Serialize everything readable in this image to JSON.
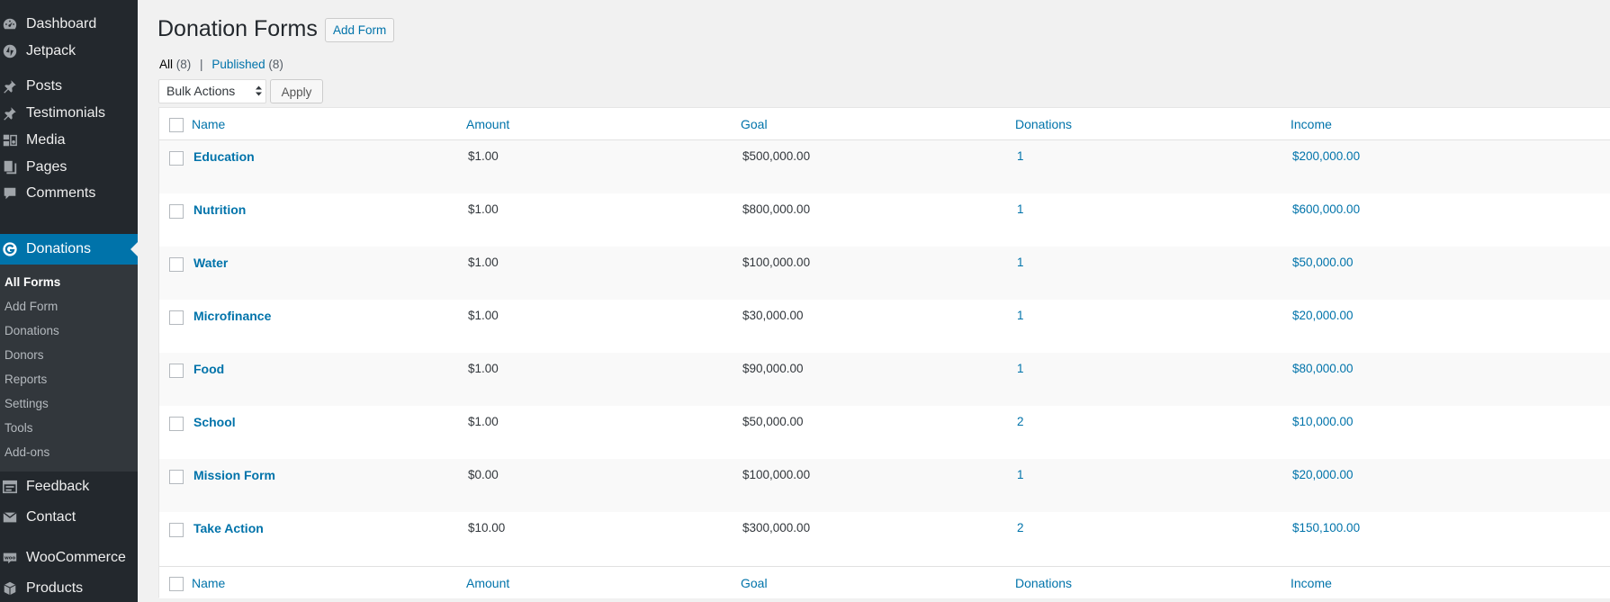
{
  "sidebar": {
    "menu": [
      {
        "label": "Dashboard",
        "icon": "dashboard-icon"
      },
      {
        "label": "Jetpack",
        "icon": "jetpack-icon"
      },
      {
        "label": "Posts",
        "icon": "pin-icon"
      },
      {
        "label": "Testimonials",
        "icon": "pin-icon"
      },
      {
        "label": "Media",
        "icon": "media-icon"
      },
      {
        "label": "Pages",
        "icon": "pages-icon"
      },
      {
        "label": "Comments",
        "icon": "comments-icon"
      },
      {
        "label": "Donations",
        "icon": "donations-icon"
      },
      {
        "label": "Feedback",
        "icon": "feedback-icon"
      },
      {
        "label": "Contact",
        "icon": "mail-icon"
      },
      {
        "label": "WooCommerce",
        "icon": "woocommerce-icon"
      },
      {
        "label": "Products",
        "icon": "products-icon"
      }
    ],
    "submenu": [
      "All Forms",
      "Add Form",
      "Donations",
      "Donors",
      "Reports",
      "Settings",
      "Tools",
      "Add-ons"
    ]
  },
  "page": {
    "title": "Donation Forms",
    "add_button": "Add Form"
  },
  "filters": {
    "all_label": "All",
    "all_count": "(8)",
    "separator": "|",
    "published_label": "Published",
    "published_count": "(8)"
  },
  "bulk": {
    "selected": "Bulk Actions",
    "apply": "Apply"
  },
  "table": {
    "columns": [
      "Name",
      "Amount",
      "Goal",
      "Donations",
      "Income"
    ],
    "rows": [
      {
        "name": "Education",
        "amount": "$1.00",
        "goal": "$500,000.00",
        "donations": "1",
        "income": "$200,000.00"
      },
      {
        "name": "Nutrition",
        "amount": "$1.00",
        "goal": "$800,000.00",
        "donations": "1",
        "income": "$600,000.00"
      },
      {
        "name": "Water",
        "amount": "$1.00",
        "goal": "$100,000.00",
        "donations": "1",
        "income": "$50,000.00"
      },
      {
        "name": "Microfinance",
        "amount": "$1.00",
        "goal": "$30,000.00",
        "donations": "1",
        "income": "$20,000.00"
      },
      {
        "name": "Food",
        "amount": "$1.00",
        "goal": "$90,000.00",
        "donations": "1",
        "income": "$80,000.00"
      },
      {
        "name": "School",
        "amount": "$1.00",
        "goal": "$50,000.00",
        "donations": "2",
        "income": "$10,000.00"
      },
      {
        "name": "Mission Form",
        "amount": "$0.00",
        "goal": "$100,000.00",
        "donations": "1",
        "income": "$20,000.00"
      },
      {
        "name": "Take Action",
        "amount": "$10.00",
        "goal": "$300,000.00",
        "donations": "2",
        "income": "$150,100.00"
      }
    ]
  },
  "colors": {
    "sidebar_bg": "#23282d",
    "submenu_bg": "#32373c",
    "accent": "#0073aa",
    "page_bg": "#f1f1f1"
  }
}
